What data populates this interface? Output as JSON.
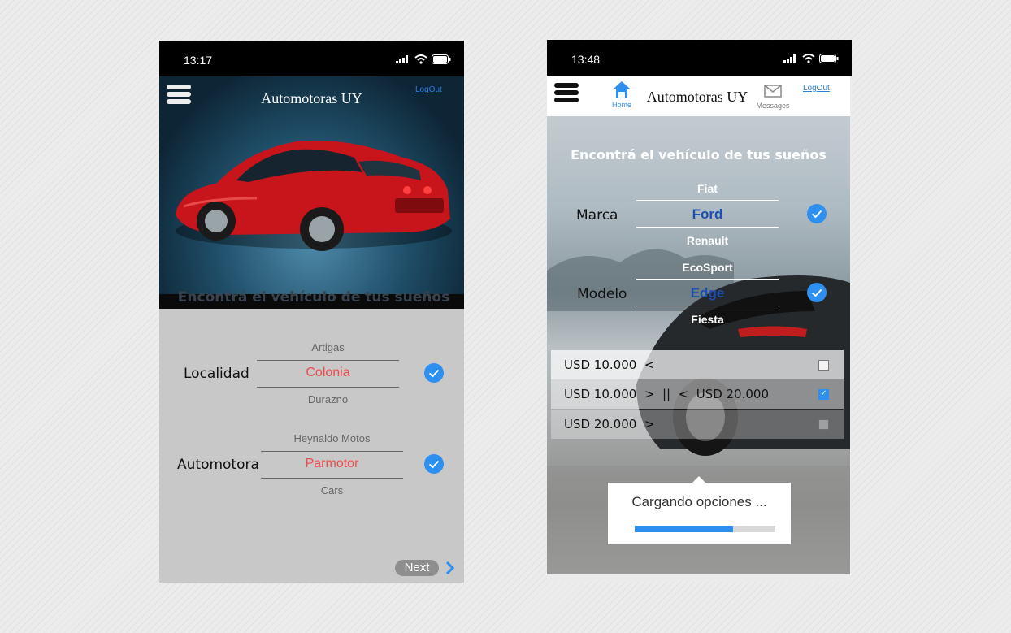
{
  "left": {
    "status": {
      "time": "13:17"
    },
    "app_title": "Automotoras UY",
    "logout": "LogOut",
    "heading": "Encontrá el vehículo de tus sueños",
    "localidad": {
      "label": "Localidad",
      "above": "Artigas",
      "selected": "Colonia",
      "below": "Durazno"
    },
    "automotora": {
      "label": "Automotora",
      "above": "Heynaldo Motos",
      "selected": "Parmotor",
      "below": "Cars"
    },
    "next": "Next"
  },
  "right": {
    "status": {
      "time": "13:48"
    },
    "app_title": "Automotoras UY",
    "home": "Home",
    "messages": "Messages",
    "logout": "LogOut",
    "heading": "Encontrá el vehículo de tus sueños",
    "marca": {
      "label": "Marca",
      "above": "Fiat",
      "selected": "Ford",
      "below": "Renault"
    },
    "modelo": {
      "label": "Modelo",
      "above": "EcoSport",
      "selected": "Edge",
      "below": "Fiesta"
    },
    "prices": [
      {
        "text": "USD 10.000  <",
        "checked": false
      },
      {
        "text": "USD 10.000  >  ||  <  USD 20.000",
        "checked": true
      },
      {
        "text": "USD 20.000  >",
        "checked": false
      }
    ],
    "loading": {
      "text": "Cargando opciones ...",
      "progress": 0.7
    }
  },
  "colors": {
    "accent_blue": "#2d8ff0",
    "picker_red": "#ef4b4b",
    "picker_blue": "#1b4fb0"
  }
}
